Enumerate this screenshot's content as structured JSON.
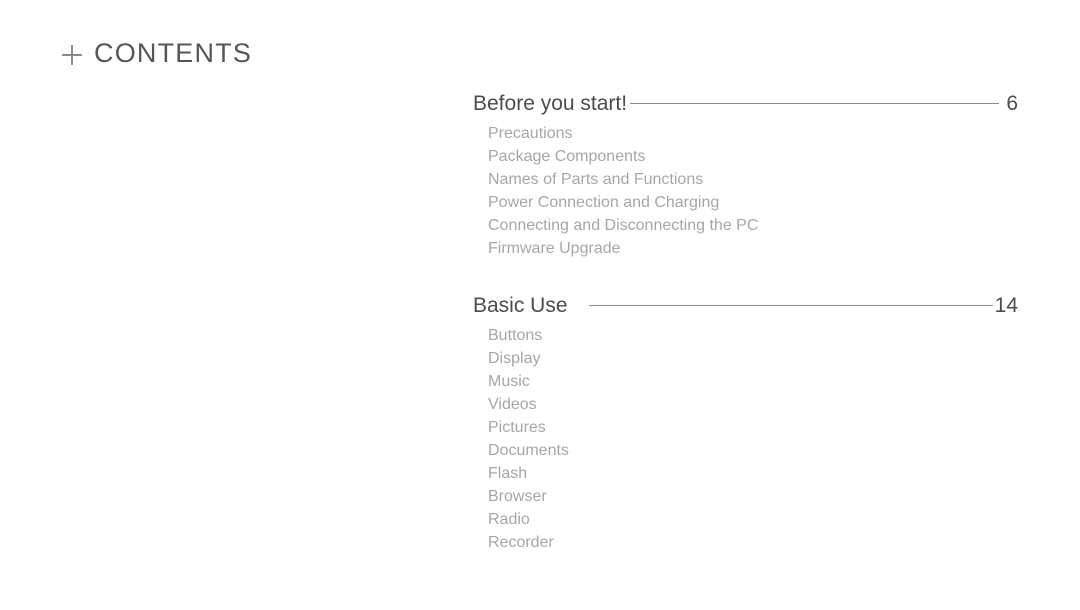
{
  "page": {
    "title": "CONTENTS",
    "title_icon": "plus-icon",
    "background_color": "#ffffff",
    "heading_color": "#4b4c50",
    "item_color": "#a6a6a8",
    "rule_color": "#8a8a8e"
  },
  "toc": {
    "sections": [
      {
        "title": "Before you start!",
        "page": "6",
        "items": [
          {
            "label": "Precautions"
          },
          {
            "label": "Package Components"
          },
          {
            "label": "Names of Parts and Functions"
          },
          {
            "label": "Power Connection and Charging"
          },
          {
            "label": "Connecting and Disconnecting the PC"
          },
          {
            "label": "Firmware Upgrade"
          }
        ]
      },
      {
        "title": "Basic Use",
        "page": "14",
        "items": [
          {
            "label": "Buttons"
          },
          {
            "label": "Display"
          },
          {
            "label": "Music"
          },
          {
            "label": "Videos"
          },
          {
            "label": "Pictures"
          },
          {
            "label": "Documents"
          },
          {
            "label": "Flash"
          },
          {
            "label": "Browser"
          },
          {
            "label": "Radio"
          },
          {
            "label": "Recorder"
          }
        ]
      }
    ]
  }
}
